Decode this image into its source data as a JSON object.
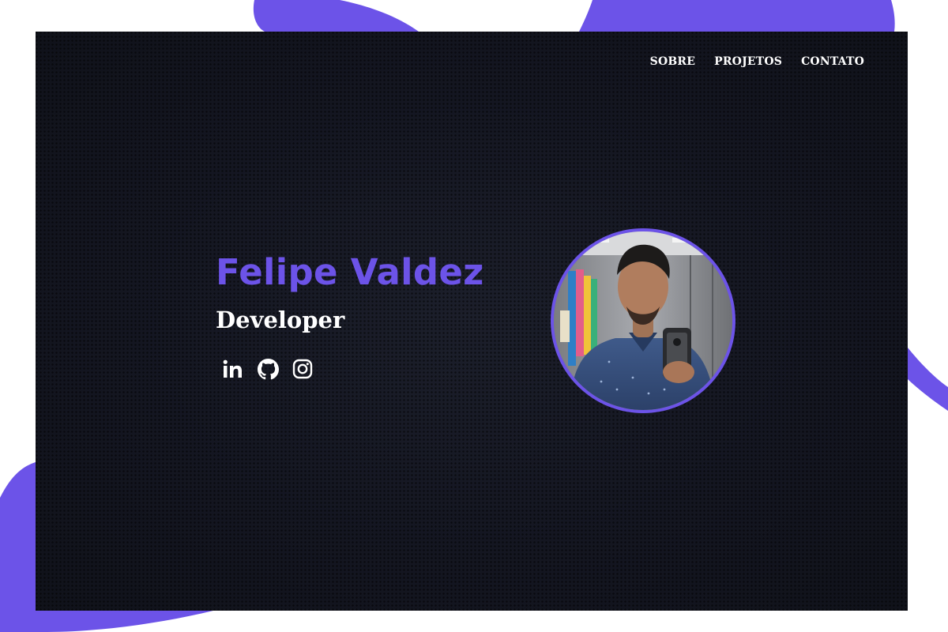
{
  "nav": {
    "items": [
      {
        "label": "SOBRE"
      },
      {
        "label": "PROJETOS"
      },
      {
        "label": "CONTATO"
      }
    ]
  },
  "hero": {
    "name": "Felipe Valdez",
    "role": "Developer"
  },
  "socials": [
    {
      "icon": "linkedin-icon"
    },
    {
      "icon": "github-icon"
    },
    {
      "icon": "instagram-icon"
    }
  ],
  "colors": {
    "accent": "#6c53e8",
    "background": "#15171f",
    "text": "#ffffff",
    "page": "#ffffff"
  }
}
